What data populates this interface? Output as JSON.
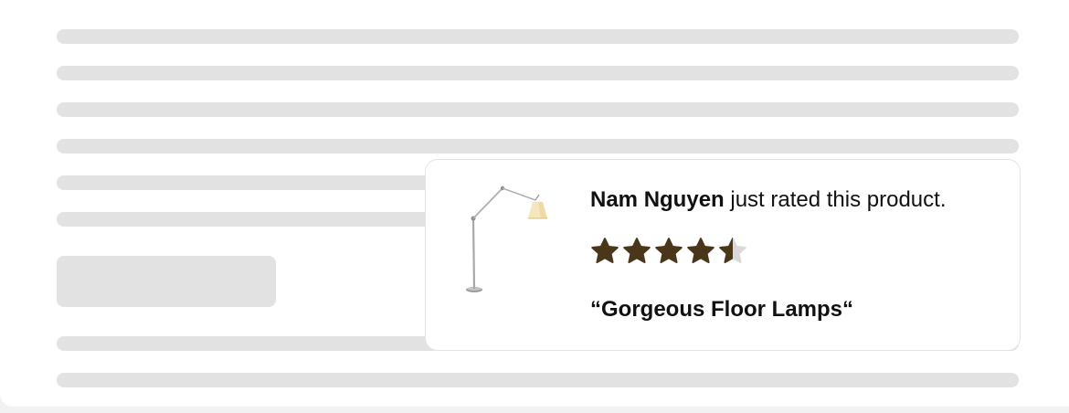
{
  "notification": {
    "reviewer_name": "Nam Nguyen",
    "action_text": " just rated this product.",
    "rating": 4.5,
    "max_rating": 5,
    "review_title": "“Gorgeous Floor Lamps“",
    "product_image": "floor-lamp",
    "star_color": "#4a3618",
    "star_empty_color": "#d9d9d9"
  }
}
